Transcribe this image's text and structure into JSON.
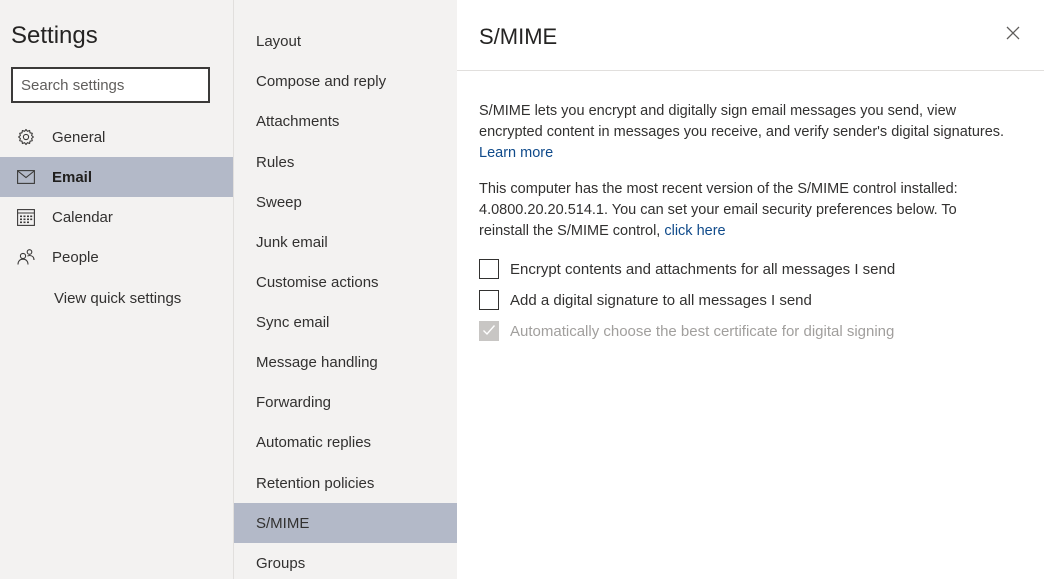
{
  "left": {
    "title": "Settings",
    "search_placeholder": "Search settings",
    "nav": [
      {
        "label": "General",
        "icon": "gear-icon"
      },
      {
        "label": "Email",
        "icon": "mail-icon",
        "selected": true
      },
      {
        "label": "Calendar",
        "icon": "calendar-icon"
      },
      {
        "label": "People",
        "icon": "people-icon"
      }
    ],
    "view_quick": "View quick settings"
  },
  "middle": {
    "items": [
      "Layout",
      "Compose and reply",
      "Attachments",
      "Rules",
      "Sweep",
      "Junk email",
      "Customise actions",
      "Sync email",
      "Message handling",
      "Forwarding",
      "Automatic replies",
      "Retention policies",
      "S/MIME",
      "Groups"
    ],
    "selected": "S/MIME"
  },
  "panel": {
    "title": "S/MIME",
    "para1": "S/MIME lets you encrypt and digitally sign email messages you send, view encrypted content in messages you receive, and verify sender's digital signatures.",
    "learn_more": "Learn more",
    "para2": "This computer has the most recent version of the S/MIME control installed: 4.0800.20.20.514.1. You can set your email security preferences below. To reinstall the S/MIME control,",
    "click_here": "click here",
    "options": [
      {
        "label": "Encrypt contents and attachments for all messages I send",
        "checked": false,
        "disabled": false
      },
      {
        "label": "Add a digital signature to all messages I send",
        "checked": false,
        "disabled": false
      },
      {
        "label": "Automatically choose the best certificate for digital signing",
        "checked": true,
        "disabled": true
      }
    ]
  }
}
